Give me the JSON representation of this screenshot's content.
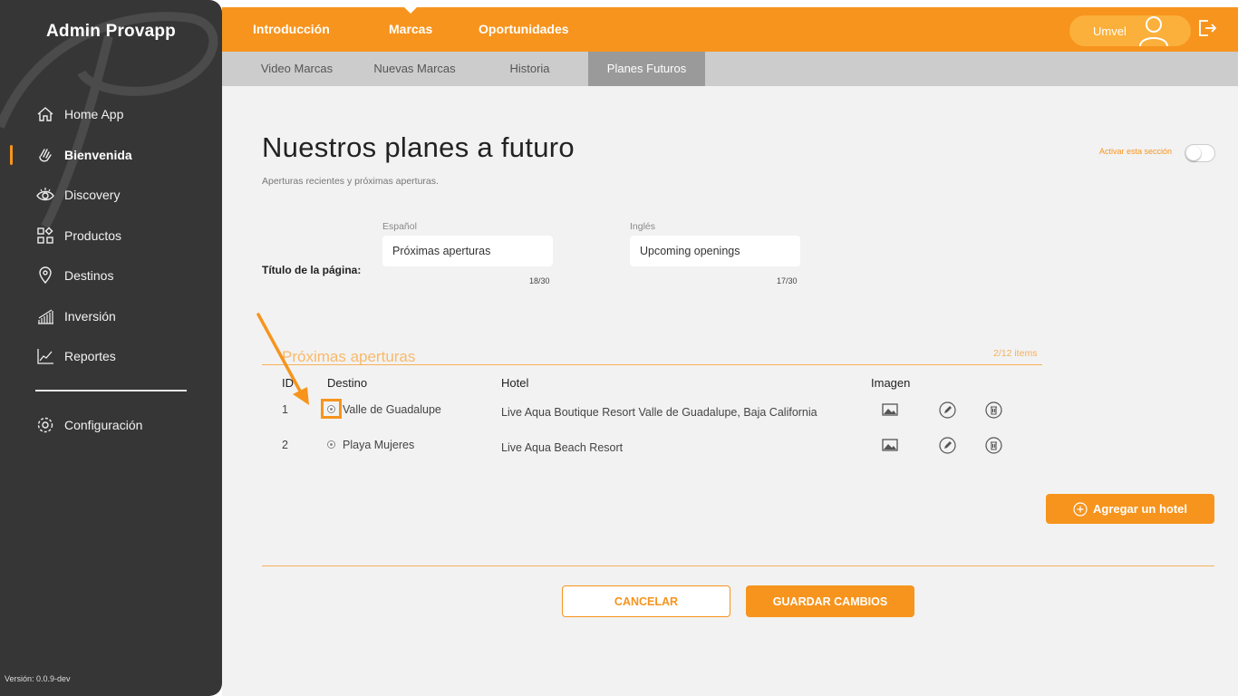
{
  "sidebar": {
    "brand": "Admin Provapp",
    "items": [
      {
        "label": "Home App",
        "icon": "home-icon"
      },
      {
        "label": "Bienvenida",
        "icon": "waving-hand-icon",
        "active": true
      },
      {
        "label": "Discovery",
        "icon": "eye-icon"
      },
      {
        "label": "Productos",
        "icon": "grid-shapes-icon"
      },
      {
        "label": "Destinos",
        "icon": "location-pin-icon"
      },
      {
        "label": "Inversión",
        "icon": "bar-growth-icon"
      },
      {
        "label": "Reportes",
        "icon": "line-chart-icon"
      }
    ],
    "config": {
      "label": "Configuración",
      "icon": "gear-icon"
    },
    "version": "Versión: 0.0.9-dev"
  },
  "topbar": {
    "tabs": [
      {
        "label": "Introducción"
      },
      {
        "label": "Marcas",
        "active": true
      },
      {
        "label": "Oportunidades"
      }
    ],
    "user": "Umvel"
  },
  "subtabs": [
    {
      "label": "Video Marcas"
    },
    {
      "label": "Nuevas Marcas"
    },
    {
      "label": "Historia"
    },
    {
      "label": "Planes Futuros",
      "active": true
    }
  ],
  "page": {
    "title": "Nuestros planes a futuro",
    "subtitle": "Aperturas recientes y próximas aperturas.",
    "activate_label": "Activar esta sección",
    "activate_on": false
  },
  "title_field": {
    "row_label": "Título de la página:",
    "es_label": "Español",
    "es_value": "Próximas aperturas",
    "es_counter": "18/30",
    "en_label": "Inglés",
    "en_value": "Upcoming openings",
    "en_counter": "17/30"
  },
  "section": {
    "title": "Próximas aperturas",
    "count": "2/12 items",
    "headers": {
      "id": "ID",
      "destino": "Destino",
      "hotel": "Hotel",
      "imagen": "Imagen"
    },
    "rows": [
      {
        "id": "1",
        "destino": "Valle de Guadalupe",
        "hotel": "Live Aqua Boutique Resort Valle de Guadalupe, Baja California"
      },
      {
        "id": "2",
        "destino": "Playa Mujeres",
        "hotel": "Live Aqua Beach Resort"
      }
    ]
  },
  "actions": {
    "add_hotel": "Agregar un hotel",
    "cancel": "CANCELAR",
    "save": "GUARDAR CAMBIOS"
  },
  "colors": {
    "accent": "#f7941d",
    "sidebar": "#363636",
    "content_bg": "#f2f2f2"
  }
}
